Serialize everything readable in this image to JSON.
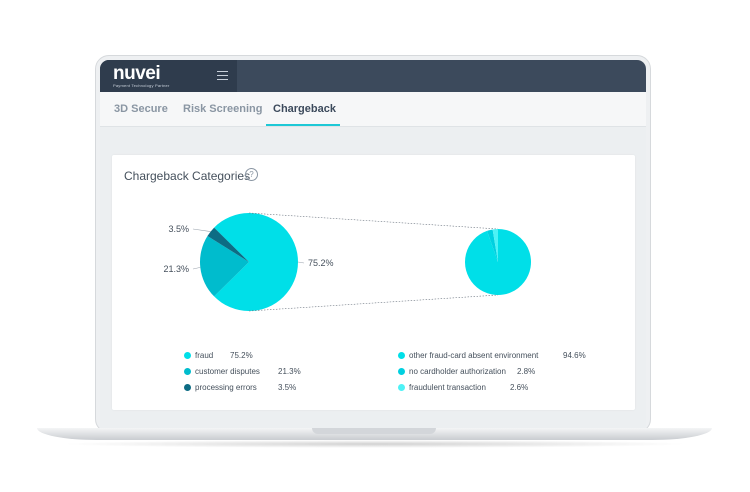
{
  "app": {
    "logo": "nuvei",
    "tagline": "Payment Technology Partner",
    "menu_icon": "hamburger-menu-icon"
  },
  "tabs": [
    {
      "label": "3D Secure",
      "active": false
    },
    {
      "label": "Risk Screening",
      "active": false
    },
    {
      "label": "Chargeback",
      "active": true
    }
  ],
  "card": {
    "title": "Chargeback Categories",
    "help_icon": "help-circle-icon",
    "help_glyph": "?"
  },
  "colors": {
    "accent": "#1ec8d6",
    "fraud": "#00dfe8",
    "customer_disputes": "#00bccd",
    "processing_errors": "#0d6c84",
    "other_fraud": "#00dfe8",
    "no_cardholder": "#00d0e0",
    "fraudulent_transaction": "#4ef2f6"
  },
  "chart_data": {
    "type": "pie",
    "main_pie": {
      "slices": [
        {
          "name": "fraud",
          "value": 75.2,
          "label": "75.2%"
        },
        {
          "name": "customer disputes",
          "value": 21.3,
          "label": "21.3%"
        },
        {
          "name": "processing errors",
          "value": 3.5,
          "label": "3.5%"
        }
      ]
    },
    "detail_pie": {
      "breakdown_of": "fraud",
      "slices": [
        {
          "name": "other fraud-card absent environment",
          "value": 94.6,
          "label": "94.6%"
        },
        {
          "name": "no cardholder authorization",
          "value": 2.8,
          "label": "2.8%"
        },
        {
          "name": "fraudulent transaction",
          "value": 2.6,
          "label": "2.6%"
        }
      ]
    },
    "legend_left": [
      {
        "label": "fraud",
        "value": "75.2%"
      },
      {
        "label": "customer disputes",
        "value": "21.3%"
      },
      {
        "label": "processing errors",
        "value": "3.5%"
      }
    ],
    "legend_right": [
      {
        "label": "other fraud-card absent environment",
        "value": "94.6%"
      },
      {
        "label": "no cardholder authorization",
        "value": "2.8%"
      },
      {
        "label": "fraudulent transaction",
        "value": "2.6%"
      }
    ]
  }
}
